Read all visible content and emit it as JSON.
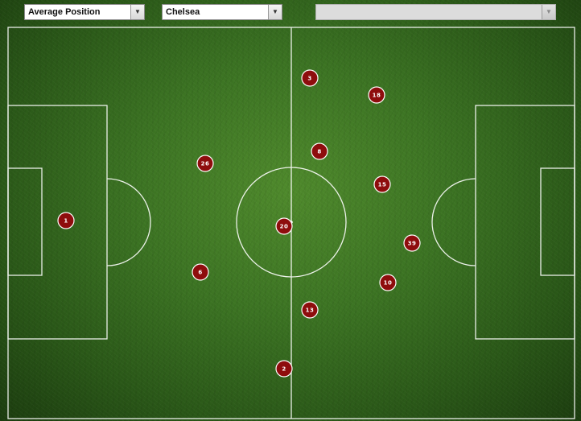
{
  "controls": {
    "view_select": {
      "value": "Average Position"
    },
    "team_select": {
      "value": "Chelsea"
    },
    "player_select": {
      "value": "",
      "disabled": true
    }
  },
  "pitch": {
    "line_color": "#ffffff",
    "player_marker_color": "#8e0d0d",
    "players": [
      {
        "number": "3"
      },
      {
        "number": "18"
      },
      {
        "number": "8"
      },
      {
        "number": "26"
      },
      {
        "number": "15"
      },
      {
        "number": "1"
      },
      {
        "number": "20"
      },
      {
        "number": "39"
      },
      {
        "number": "6"
      },
      {
        "number": "10"
      },
      {
        "number": "13"
      },
      {
        "number": "2"
      }
    ]
  }
}
